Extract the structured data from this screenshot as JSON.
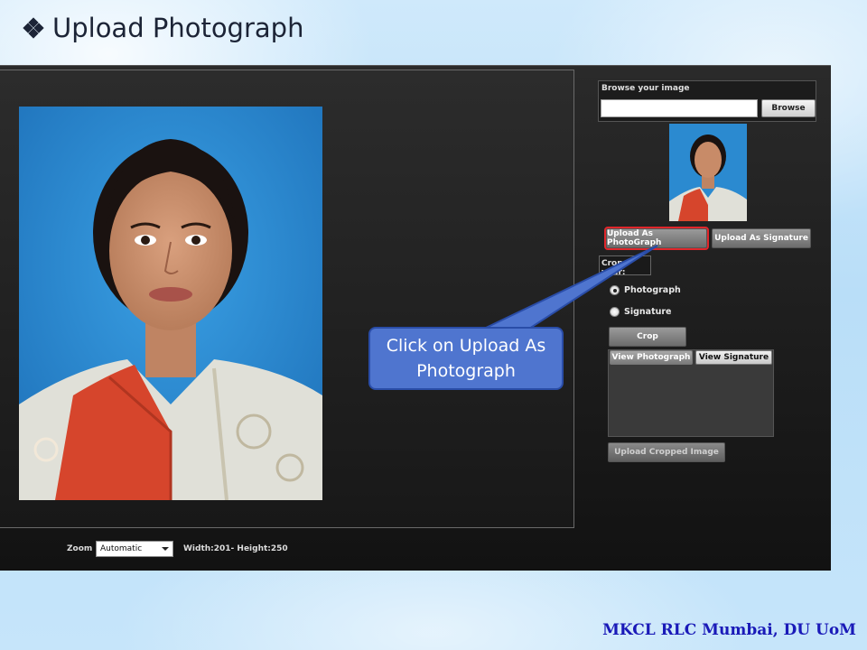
{
  "slide": {
    "title": "Upload Photograph",
    "footer": "MKCL RLC Mumbai, DU UoM"
  },
  "app": {
    "browse": {
      "label": "Browse your image",
      "input_value": "",
      "button": "Browse"
    },
    "upload_buttons": {
      "photograph": "Upload As PhotoGraph",
      "signature": "Upload As Signature"
    },
    "crop_section_label": "Crop your:",
    "radio_options": [
      {
        "label": "Photograph",
        "checked": true
      },
      {
        "label": "Signature",
        "checked": false
      }
    ],
    "crop_button": "Crop",
    "view_tabs": {
      "photograph": "View Photograph",
      "signature": "View Signature"
    },
    "upload_cropped_button": "Upload Cropped Image",
    "bottom_bar": {
      "zoom_label": "Zoom :",
      "zoom_value": "Automatic",
      "dimensions": "Width:201- Height:250"
    }
  },
  "callout": {
    "text": "Click on Upload As Photograph"
  },
  "colors": {
    "callout_fill": "#4f75cf",
    "highlight_border": "#e0262b",
    "footer_text": "#1a1ab8"
  }
}
